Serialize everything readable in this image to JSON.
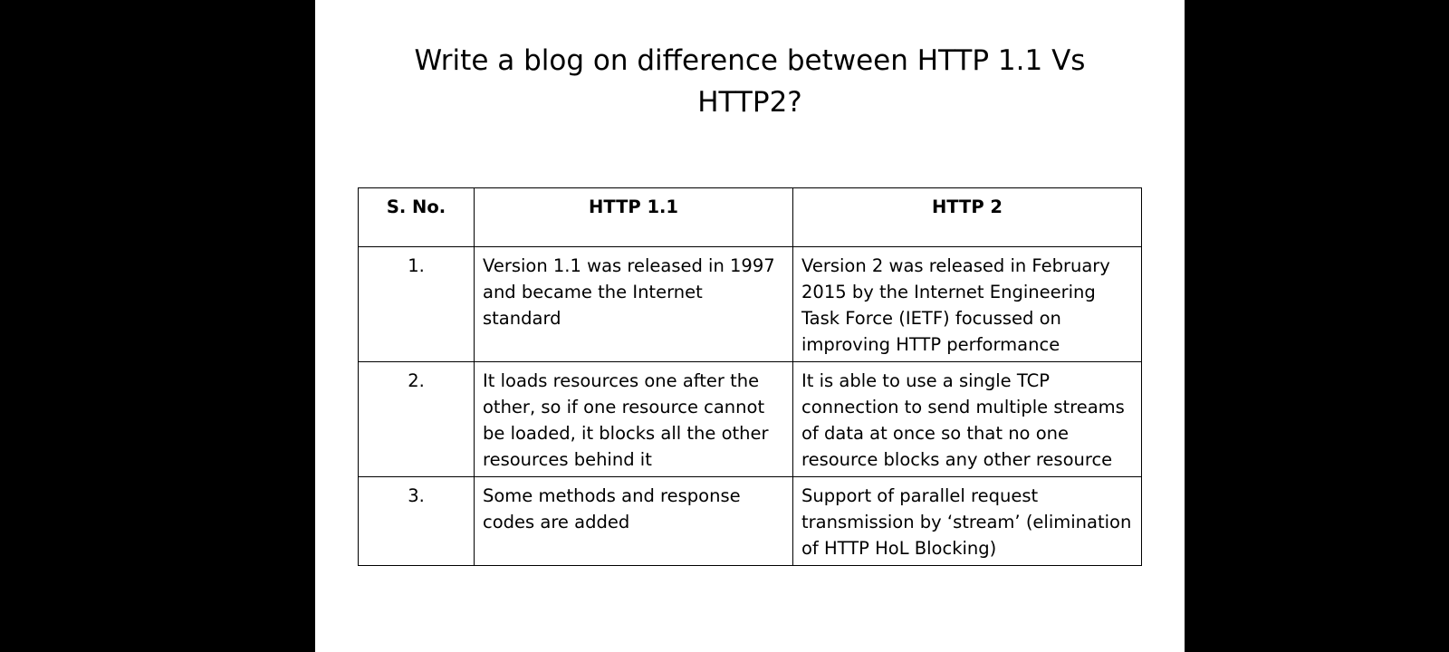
{
  "slide": {
    "title": "Write a blog on difference between HTTP 1.1 Vs HTTP2?"
  },
  "table": {
    "headers": [
      "S. No.",
      "HTTP 1.1",
      "HTTP 2"
    ],
    "rows": [
      {
        "sno": "1.",
        "http11": "Version 1.1 was released in 1997 and became the Internet standard",
        "http2": "Version 2 was released in February 2015 by the Internet Engineering Task Force (IETF) focussed on improving HTTP performance"
      },
      {
        "sno": "2.",
        "http11": "It loads resources one after the other, so if one resource cannot be loaded, it blocks all the other resources behind it",
        "http2": "It is able to use a single TCP connection to send multiple streams of data at once so that no one resource blocks any other resource"
      },
      {
        "sno": "3.",
        "http11": "Some methods and response codes are added",
        "http2": "Support of parallel request transmission by ‘stream’ (elimination of HTTP HoL Blocking)"
      }
    ]
  }
}
